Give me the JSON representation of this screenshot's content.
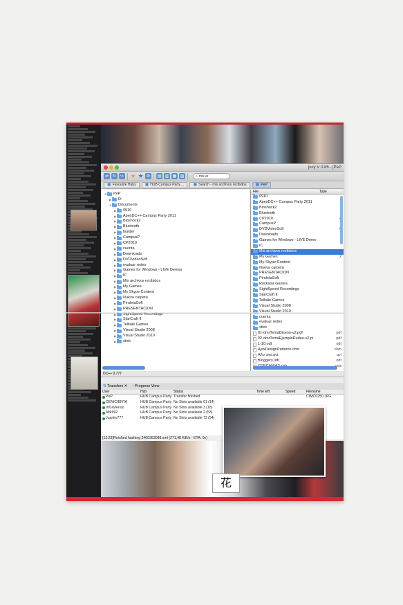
{
  "window": {
    "title": "jucy V 0.85 - [PeP"
  },
  "toolbar": {
    "search_value": "mis ar"
  },
  "tabs": [
    {
      "label": "Favourite Hubs"
    },
    {
      "label": "HUB Campus Party ..."
    },
    {
      "label": "Search - mis archivos recibidos"
    },
    {
      "label": "PeP"
    }
  ],
  "left_tree": [
    {
      "label": "PeP",
      "depth": 0,
      "type": "folder",
      "expanded": true
    },
    {
      "label": "D:",
      "depth": 1,
      "type": "folder"
    },
    {
      "label": "Documents",
      "depth": 1,
      "type": "folder",
      "expanded": true
    },
    {
      "label": "0910",
      "depth": 2,
      "type": "folder"
    },
    {
      "label": "ApexDC++ Campus Party 2011",
      "depth": 2,
      "type": "folder"
    },
    {
      "label": "Bioshock2",
      "depth": 2,
      "type": "folder"
    },
    {
      "label": "Bluetooth",
      "depth": 2,
      "type": "folder"
    },
    {
      "label": "builder",
      "depth": 2,
      "type": "folder"
    },
    {
      "label": "CampusP",
      "depth": 2,
      "type": "folder"
    },
    {
      "label": "CP2010",
      "depth": 2,
      "type": "folder"
    },
    {
      "label": "cuenta",
      "depth": 2,
      "type": "folder"
    },
    {
      "label": "Downloads",
      "depth": 2,
      "type": "folder"
    },
    {
      "label": "DVDVideoSoft",
      "depth": 2,
      "type": "folder"
    },
    {
      "label": "evaluar redes",
      "depth": 2,
      "type": "folder"
    },
    {
      "label": "Games for Windows - LIVE Demos",
      "depth": 2,
      "type": "folder"
    },
    {
      "label": "IC",
      "depth": 2,
      "type": "folder"
    },
    {
      "label": "Mis archivos recibidos",
      "depth": 2,
      "type": "folder"
    },
    {
      "label": "My Games",
      "depth": 2,
      "type": "folder"
    },
    {
      "label": "My Skype Content",
      "depth": 2,
      "type": "folder"
    },
    {
      "label": "Nueva carpeta",
      "depth": 2,
      "type": "folder"
    },
    {
      "label": "PiruletaSoft",
      "depth": 2,
      "type": "folder"
    },
    {
      "label": "PRESENTACION",
      "depth": 2,
      "type": "folder"
    },
    {
      "label": "SightSpeed Recordings",
      "depth": 2,
      "type": "folder"
    },
    {
      "label": "StarCraft II",
      "depth": 2,
      "type": "folder"
    },
    {
      "label": "Telltale Games",
      "depth": 2,
      "type": "folder"
    },
    {
      "label": "Visual Studio 2008",
      "depth": 2,
      "type": "folder"
    },
    {
      "label": "Visual Studio 2010",
      "depth": 2,
      "type": "folder"
    },
    {
      "label": "xtick",
      "depth": 2,
      "type": "folder"
    }
  ],
  "right_header": {
    "file": "File",
    "type": "Type"
  },
  "right_list": [
    {
      "label": "0910",
      "type": "folder",
      "ext": ""
    },
    {
      "label": "ApexDC++ Campus Party 2011",
      "type": "folder",
      "ext": ""
    },
    {
      "label": "Bioshock2",
      "type": "folder",
      "ext": ""
    },
    {
      "label": "Bluetooth",
      "type": "folder",
      "ext": ""
    },
    {
      "label": "CP2010",
      "type": "folder",
      "ext": "4"
    },
    {
      "label": "CampusP",
      "type": "folder",
      "ext": ""
    },
    {
      "label": "DVDVideoSoft",
      "type": "folder",
      "ext": "6"
    },
    {
      "label": "Downloads",
      "type": "folder",
      "ext": ""
    },
    {
      "label": "Games for Windows - LIVE Demo",
      "type": "folder",
      "ext": ""
    },
    {
      "label": "IC",
      "type": "folder",
      "ext": ""
    },
    {
      "label": "Mis archivos recibidos",
      "type": "folder",
      "ext": "",
      "selected": true
    },
    {
      "label": "My Games",
      "type": "folder",
      "ext": "2"
    },
    {
      "label": "My Skype Content",
      "type": "folder",
      "ext": ""
    },
    {
      "label": "Nueva carpeta",
      "type": "folder",
      "ext": ""
    },
    {
      "label": "PRESENTACION",
      "type": "folder",
      "ext": ""
    },
    {
      "label": "PiruletaSoft",
      "type": "folder",
      "ext": ""
    },
    {
      "label": "Rockstar Games",
      "type": "folder",
      "ext": ""
    },
    {
      "label": "SightSpeed Recordings",
      "type": "folder",
      "ext": ""
    },
    {
      "label": "StarCraft II",
      "type": "folder",
      "ext": ""
    },
    {
      "label": "Telltale Games",
      "type": "folder",
      "ext": ""
    },
    {
      "label": "Visual Studio 2008",
      "type": "folder",
      "ext": ""
    },
    {
      "label": "Visual Studio 2010",
      "type": "folder",
      "ext": ""
    },
    {
      "label": "cuenta",
      "type": "folder",
      "ext": ""
    },
    {
      "label": "evaluar redes",
      "type": "folder",
      "ext": ""
    },
    {
      "label": "xtick",
      "type": "folder",
      "ext": ""
    },
    {
      "label": "01-dmrTemaDiseno-v2.pdf",
      "type": "file",
      "ext": "pdf"
    },
    {
      "label": "02-dmrTemaEjemploRedes-v2.pi",
      "type": "file",
      "ext": "pdf"
    },
    {
      "label": "1-10.odt",
      "type": "file",
      "ext": "odt"
    },
    {
      "label": "AjaxDesignPatterns.chm",
      "type": "file",
      "ext": "chm"
    },
    {
      "label": "Año uno.avi",
      "type": "file",
      "ext": "avi"
    },
    {
      "label": "Bloggers.odt",
      "type": "file",
      "ext": "odt"
    },
    {
      "label": "CERCANIAS.ods",
      "type": "file",
      "ext": "ods"
    }
  ],
  "status": {
    "text": "DC++ 0.777"
  },
  "transfers": {
    "tab_transfers": "Transfers",
    "tab_progress": "Progress View",
    "headers": {
      "user": "User",
      "hub": "Hub",
      "status": "Status",
      "time": "Time left",
      "speed": "Speed",
      "file": "Filename"
    },
    "rows": [
      {
        "user": "PeP",
        "hub": "HUB Campus Party",
        "status": "Transfer finished",
        "file": "CIMC0250.JPG"
      },
      {
        "user": "CENICIENTA",
        "hub": "HUB Campus Party",
        "status": "No Slots available 61 (14)",
        "file": ""
      },
      {
        "user": "InfJavieruiz",
        "hub": "HUB Campus Party",
        "status": "No Slots available 3 (18)",
        "file": ""
      },
      {
        "user": "Mrk992",
        "hub": "HUB Campus Party",
        "status": "No Slots available 2 (53)",
        "file": ""
      },
      {
        "user": "Juanky777",
        "hub": "HUB Campus Party",
        "status": "No Slots available 73 (54)",
        "file": ""
      }
    ]
  },
  "log": {
    "text": "[12:23]Finished hashing 2400363098.xml (271,48 KiB/s - ETA: 0s)"
  },
  "kanji": "花"
}
